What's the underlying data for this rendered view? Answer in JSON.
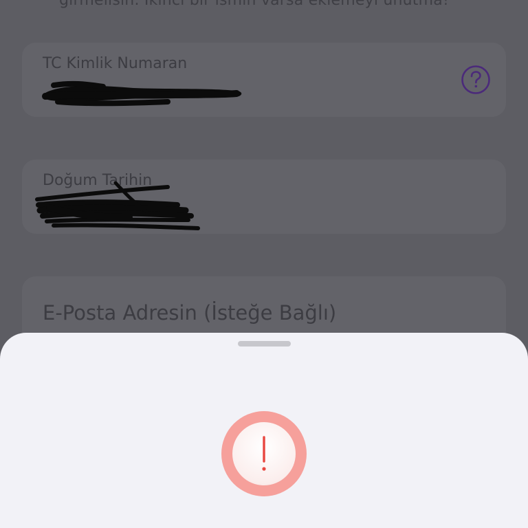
{
  "form": {
    "name_hint": "girmelisin. İkinci bir ismin varsa eklemeyi unutma!",
    "tc": {
      "label": "TC Kimlik Numaran",
      "value": "[redacted]"
    },
    "dob": {
      "label": "Doğum Tarihin",
      "value": "[redacted]"
    },
    "email": {
      "placeholder": "E-Posta Adresin (İsteğe Bağlı)"
    }
  },
  "icons": {
    "help": "question-circle-icon",
    "alert": "exclamation-icon"
  },
  "colors": {
    "overlay_background": "#5d5d63",
    "help_icon": "#4b2a7a",
    "sheet_background": "#f2f2f7",
    "alert_ring": "#f6a09b",
    "alert_glyph": "#e8463f"
  },
  "redaction_note": "Values obscured by black scribbles"
}
